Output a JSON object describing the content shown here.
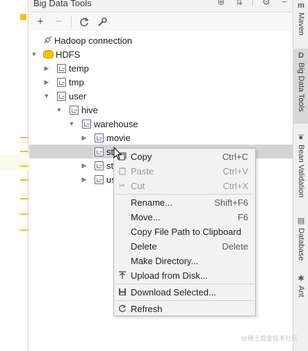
{
  "tool_window": {
    "title": "Big Data Tools"
  },
  "toolbar": {
    "add": "+",
    "remove": "−"
  },
  "tree": {
    "connection": "Hadoop connection",
    "hdfs": "HDFS",
    "temp": "temp",
    "tmp": "tmp",
    "user": "user",
    "hive": "hive",
    "warehouse": "warehouse",
    "movie": "movie",
    "selected_partial": "st",
    "item2_partial": "st",
    "item3_partial": "us"
  },
  "context_menu": {
    "items": [
      {
        "label": "Copy",
        "shortcut": "Ctrl+C",
        "enabled": true
      },
      {
        "label": "Paste",
        "shortcut": "Ctrl+V",
        "enabled": false
      },
      {
        "label": "Cut",
        "shortcut": "Ctrl+X",
        "enabled": false
      },
      {
        "label": "Rename...",
        "shortcut": "Shift+F6",
        "enabled": true
      },
      {
        "label": "Move...",
        "shortcut": "F6",
        "enabled": true
      },
      {
        "label": "Copy File Path to Clipboard",
        "shortcut": "",
        "enabled": true
      },
      {
        "label": "Delete",
        "shortcut": "Delete",
        "enabled": true
      },
      {
        "label": "Make Directory...",
        "shortcut": "",
        "enabled": true
      },
      {
        "label": "Upload from Disk...",
        "shortcut": "",
        "enabled": true
      },
      {
        "label": "Download Selected...",
        "shortcut": "",
        "enabled": true
      },
      {
        "label": "Refresh",
        "shortcut": "",
        "enabled": true
      }
    ]
  },
  "right_stripe": {
    "maven": "Maven",
    "big_data_tools": "Big Data Tools",
    "bean_validation": "Bean Validation",
    "database": "Database",
    "ant": "Ant",
    "maven_icon": "m",
    "bigdata_icon": "D"
  },
  "watermark": "@稀土掘金技术社区",
  "colors": {
    "selection": "#d4d4d4",
    "menu_bg": "#f2f2f2",
    "hdfs_icon": "#f4c20d",
    "folder_accent": "#4a7cc7"
  }
}
